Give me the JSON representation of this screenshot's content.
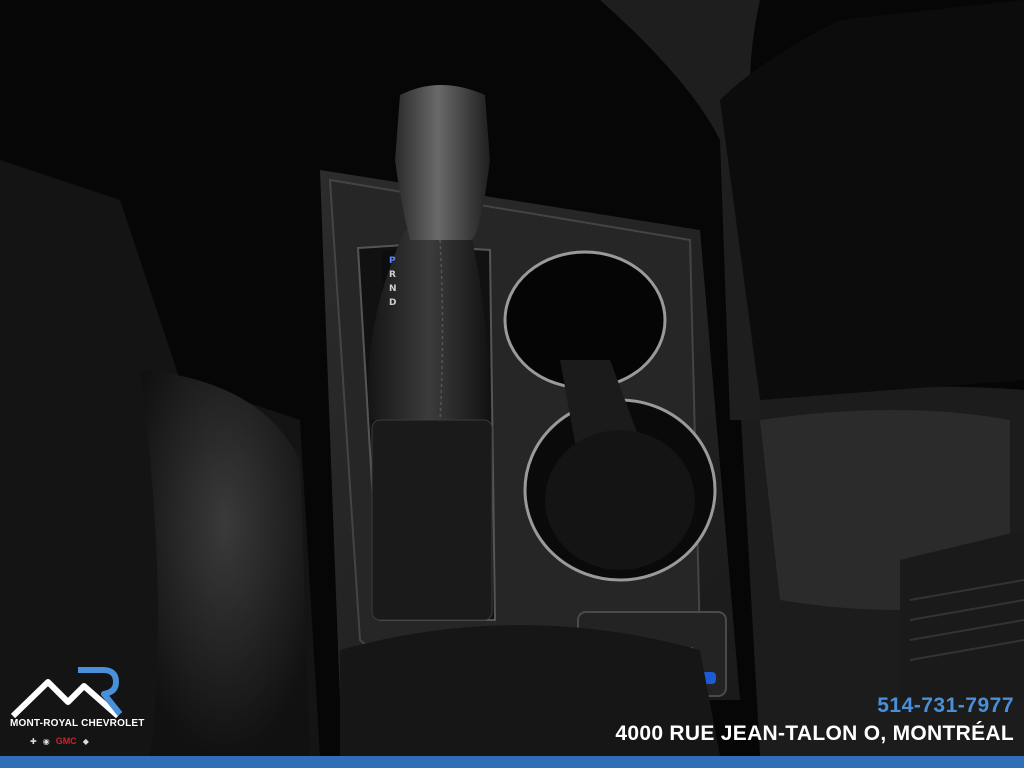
{
  "dealer": {
    "name": "MONT-ROYAL CHEVROLET",
    "phone": "514-731-7977",
    "address": "4000 RUE JEAN-TALON O, MONTRÉAL",
    "brands": [
      "Chevrolet",
      "Buick",
      "GMC",
      "Cadillac"
    ],
    "gmc_label": "GMC"
  },
  "shifter": {
    "gears": [
      "P",
      "R",
      "N",
      "D"
    ]
  },
  "colors": {
    "accent_blue": "#2f6fb6",
    "phone_blue": "#4a8fd9"
  },
  "icons": [
    "heated-seat-left-icon",
    "heated-seat-right-icon"
  ]
}
